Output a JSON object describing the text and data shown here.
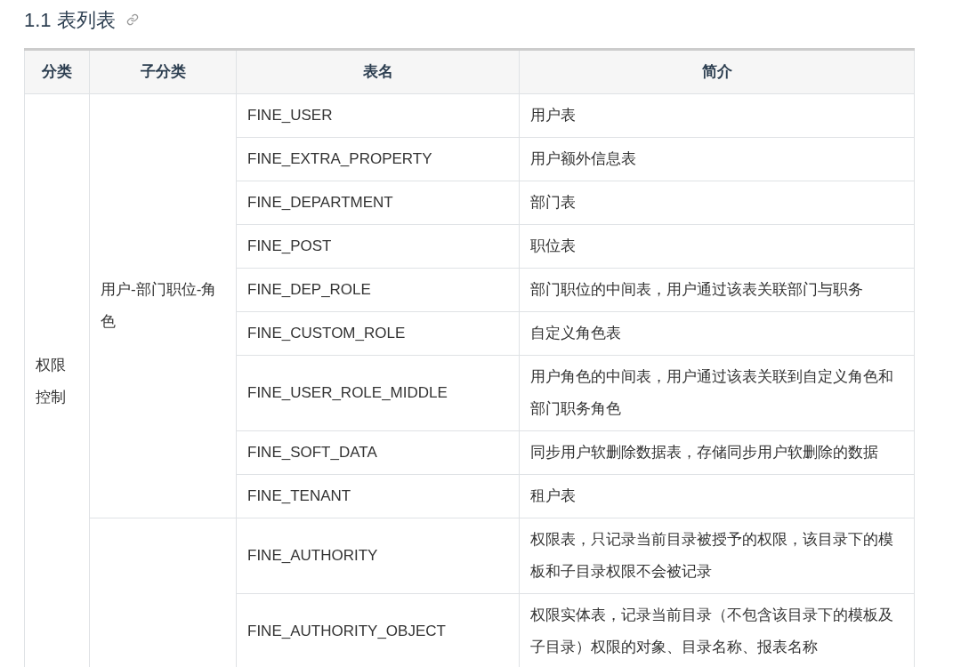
{
  "title": "1.1 表列表",
  "columns": [
    "分类",
    "子分类",
    "表名",
    "简介"
  ],
  "groups": [
    {
      "category": "权限控制",
      "subgroups": [
        {
          "name": "用户-部门职位-角色",
          "rows": [
            {
              "table": "FINE_USER",
              "desc": "用户表"
            },
            {
              "table": "FINE_EXTRA_PROPERTY",
              "desc": "用户额外信息表"
            },
            {
              "table": "FINE_DEPARTMENT",
              "desc": "部门表"
            },
            {
              "table": "FINE_POST",
              "desc": "职位表"
            },
            {
              "table": "FINE_DEP_ROLE",
              "desc": "部门职位的中间表，用户通过该表关联部门与职务"
            },
            {
              "table": "FINE_CUSTOM_ROLE",
              "desc": "自定义角色表"
            },
            {
              "table": "FINE_USER_ROLE_MIDDLE",
              "desc": "用户角色的中间表，用户通过该表关联到自定义角色和部门职务角色"
            },
            {
              "table": "FINE_SOFT_DATA",
              "desc": "同步用户软删除数据表，存储同步用户软删除的数据"
            },
            {
              "table": "FINE_TENANT",
              "desc": "租户表"
            }
          ]
        },
        {
          "rows": [
            {
              "table": "FINE_AUTHORITY",
              "desc": "权限表，只记录当前目录被授予的权限，该目录下的模板和子目录权限不会被记录"
            },
            {
              "table": "FINE_AUTHORITY_OBJECT",
              "desc": "权限实体表，记录当前目录（不包含该目录下的模板及子目录）权限的对象、目录名称、报表名称"
            }
          ]
        }
      ]
    }
  ]
}
